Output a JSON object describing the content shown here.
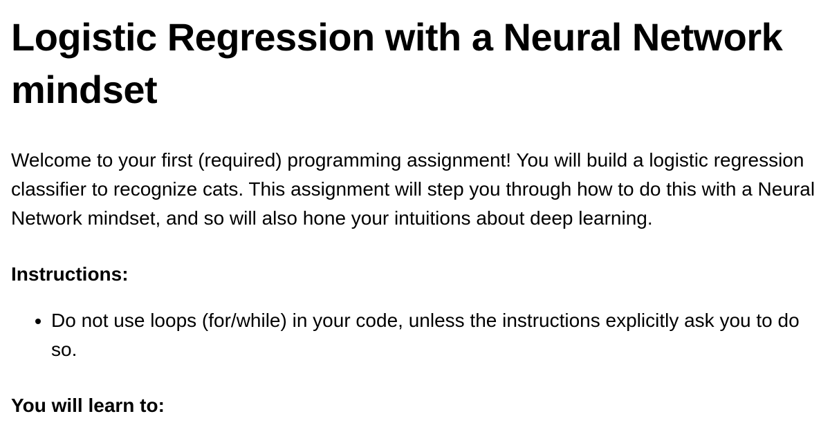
{
  "title": "Logistic Regression with a Neural Network mindset",
  "intro": "Welcome to your first (required) programming assignment! You will build a logistic regression classifier to recognize cats. This assignment will step you through how to do this with a Neural Network mindset, and so will also hone your intuitions about deep learning.",
  "instructions_label": "Instructions:",
  "instructions": [
    "Do not use loops (for/while) in your code, unless the instructions explicitly ask you to do so."
  ],
  "learn_label": "You will learn to:"
}
